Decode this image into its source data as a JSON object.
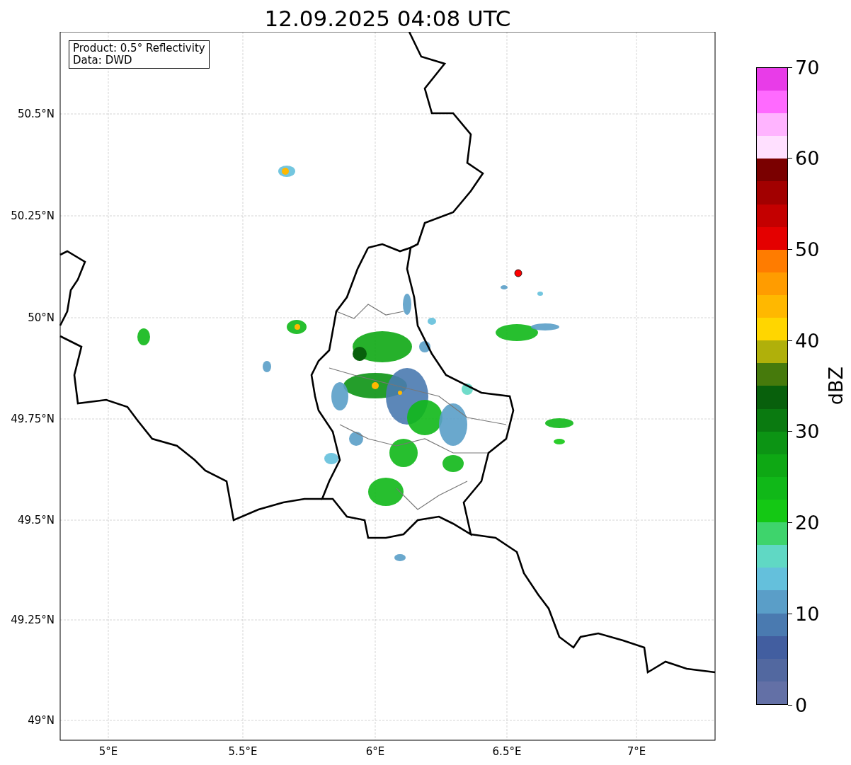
{
  "title": "12.09.2025 04:08 UTC",
  "info_box": {
    "lines": [
      "Product: 0.5° Reflectivity",
      "Data: DWD"
    ]
  },
  "y_ticks": [
    "50.5°N",
    "50.25°N",
    "50°N",
    "49.75°N",
    "49.5°N",
    "49.25°N",
    "49°N"
  ],
  "x_ticks": [
    "5°E",
    "5.5°E",
    "6°E",
    "6.5°E",
    "7°E"
  ],
  "colorbar": {
    "label": "dBZ",
    "ticks": [
      "70",
      "60",
      "50",
      "40",
      "30",
      "20",
      "10",
      "0"
    ],
    "segments": [
      {
        "color": "#6370a6"
      },
      {
        "color": "#5268a0"
      },
      {
        "color": "#425ea0"
      },
      {
        "color": "#4a7ab0"
      },
      {
        "color": "#5a9ec8"
      },
      {
        "color": "#64c0dc"
      },
      {
        "color": "#60d8c4"
      },
      {
        "color": "#3ed46c"
      },
      {
        "color": "#14c814"
      },
      {
        "color": "#10b818"
      },
      {
        "color": "#0ea814"
      },
      {
        "color": "#0c9414"
      },
      {
        "color": "#0a7a10"
      },
      {
        "color": "#08600c"
      },
      {
        "color": "#467a0c"
      },
      {
        "color": "#b0b00a"
      },
      {
        "color": "#ffd600"
      },
      {
        "color": "#ffb800"
      },
      {
        "color": "#ff9c00"
      },
      {
        "color": "#ff7c00"
      },
      {
        "color": "#e40000"
      },
      {
        "color": "#c40000"
      },
      {
        "color": "#a20000"
      },
      {
        "color": "#7a0000"
      },
      {
        "color": "#ffe0ff"
      },
      {
        "color": "#ffb4ff"
      },
      {
        "color": "#ff6aff"
      },
      {
        "color": "#e83ce8"
      }
    ]
  }
}
